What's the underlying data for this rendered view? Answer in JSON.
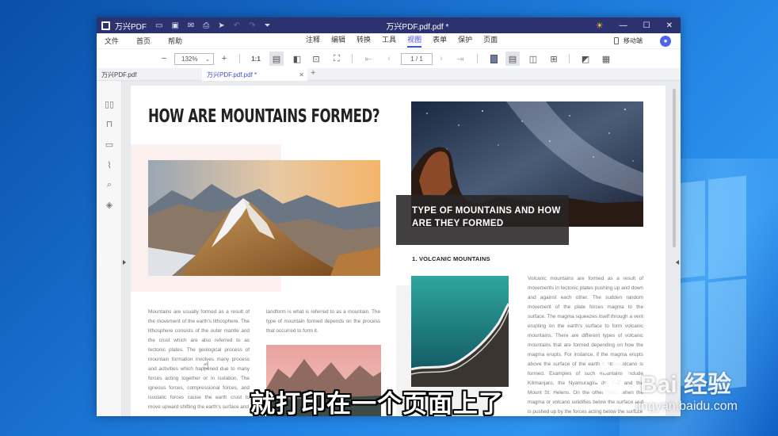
{
  "titlebar": {
    "app_name": "万兴PDF",
    "document_title": "万兴PDF.pdf.pdf *"
  },
  "menubar": {
    "left_items": [
      "文件",
      "首页",
      "帮助"
    ],
    "center_items": [
      {
        "label": "注释",
        "active": false
      },
      {
        "label": "编辑",
        "active": false
      },
      {
        "label": "转换",
        "active": false
      },
      {
        "label": "工具",
        "active": false
      },
      {
        "label": "视图",
        "active": true
      },
      {
        "label": "表单",
        "active": false
      },
      {
        "label": "保护",
        "active": false
      },
      {
        "label": "页面",
        "active": false
      }
    ],
    "mobile_label": "移动端"
  },
  "toolbar": {
    "zoom_value": "132%",
    "page_value": "1 / 1"
  },
  "tabs": [
    {
      "label": "万兴PDF.pdf",
      "active": false
    },
    {
      "label": "万兴PDF.pdf.pdf *",
      "active": true
    }
  ],
  "document": {
    "headline": "HOW ARE MOUNTAINS FORMED?",
    "overlay_title_line1": "TYPE OF MOUNTAINS AND HOW",
    "overlay_title_line2": "ARE THEY FORMED",
    "subhead": "1. VOLCANIC MOUNTAINS",
    "col1_text": "Mountains are usually formed as a result of the movement of the earth's lithosphere. The lithosphere consists of the outer mantle and the crust which are also referred to as tectonic plates. The geological process of mountain formation involves many process and activities which happened due to many forces acting together or in isolation. The igneous forces, compressional forces, and isostatic forces cause the earth crust to move upward shifting the earth's surface and",
    "col2_text": "landform is what is referred to as a mountain. The type of mountain formed depends on the process that occurred to form it.",
    "col3_text": "Volcanic mountains are formed as a result of movements in tectonic plates pushing up and down and against each other. The sudden random movement of the plate forces magma to the surface. The magma squeezes itself through a vent erupting on the earth's surface to form volcanic mountains. There are different types of volcanic mountains that are formed depending on how the magma erupts. For instance, if the magma erupts above the surface of the earth a stratovolcano is formed. Examples of such mountains include Kilimanjaro, the Nyamuragira the Fuji and the Mount St. Helens. On the other hand, when the magma or volcano solidifies below the surface and is pushed up by the forces acting below the surface"
  },
  "overlay": {
    "subtitle": "就打印在一个页面上了",
    "watermark_text": "Bai 经验",
    "watermark_url": "jingyan.baidu.com"
  }
}
